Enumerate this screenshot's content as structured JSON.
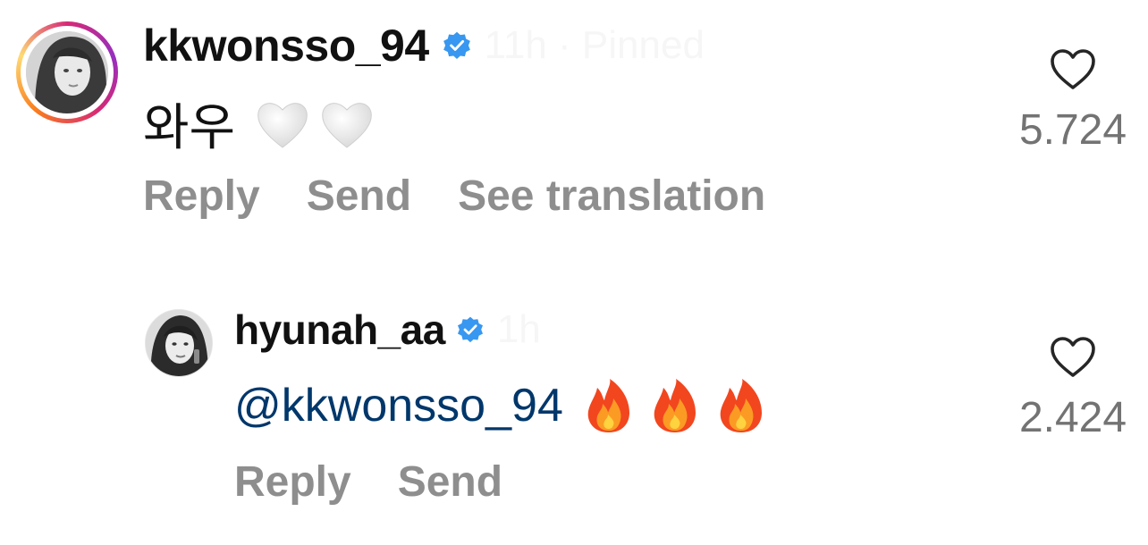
{
  "comments": [
    {
      "username": "kkwonsso_94",
      "verified": true,
      "faded_meta": "11h · Pinned",
      "text": "와우",
      "emojis": [
        "white-heart",
        "white-heart"
      ],
      "actions": [
        "Reply",
        "Send",
        "See translation"
      ],
      "like_count": "5.724"
    },
    {
      "username": "hyunah_aa",
      "verified": true,
      "faded_meta": "1h",
      "mention": "@kkwonsso_94",
      "emojis": [
        "fire",
        "fire",
        "fire"
      ],
      "actions": [
        "Reply",
        "Send"
      ],
      "like_count": "2.424"
    }
  ],
  "colors": {
    "verified_blue": "#3897f0",
    "mention_blue": "#00376b",
    "muted_text": "#8e8e8e",
    "count_text": "#737373"
  },
  "icons": {
    "verified": "verified-badge-icon",
    "like": "heart-outline-icon"
  }
}
